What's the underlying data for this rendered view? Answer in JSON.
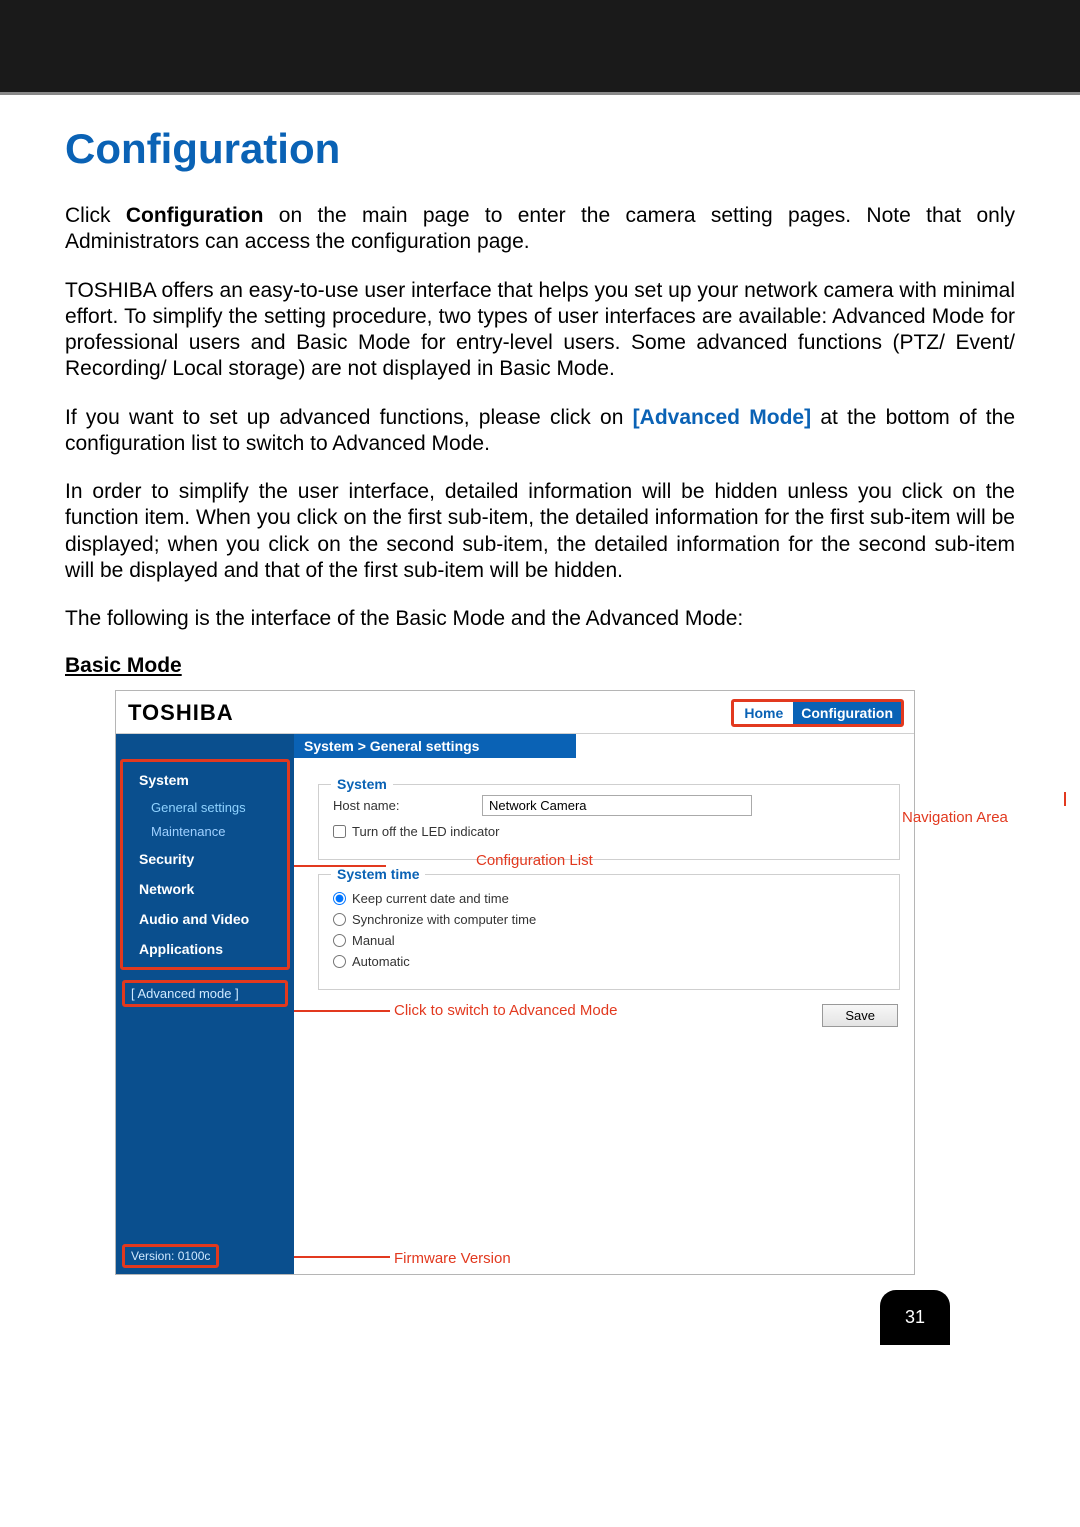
{
  "title": "Configuration",
  "para1_pre": "Click ",
  "para1_bold": "Configuration",
  "para1_post": " on the main page to enter the camera setting pages. Note that only Administrators can access the configuration page.",
  "para2": "TOSHIBA offers an easy-to-use user interface that helps you set up your network camera with minimal effort. To simplify the setting procedure, two types of user interfaces are available: Advanced Mode for professional users and Basic Mode for entry-level users. Some advanced functions (PTZ/ Event/ Recording/ Local storage) are not displayed in Basic Mode.",
  "para3_pre": "If you want to set up advanced functions, please click on ",
  "para3_link": "[Advanced Mode]",
  "para3_post": " at the bottom of the configuration list to switch to Advanced Mode.",
  "para4": "In order to simplify the user interface, detailed information will be hidden unless you click on the function item. When you click on the first sub-item, the detailed information for the first sub-item will be displayed; when you click on the second sub-item, the detailed information for the second sub-item will be displayed and that of the first sub-item will be hidden.",
  "para5": "The following is the interface of the Basic Mode and the Advanced Mode:",
  "subhead": "Basic Mode",
  "shot": {
    "brand": "TOSHIBA",
    "nav_home": "Home",
    "nav_config": "Configuration",
    "breadcrumb": "System  >  General settings",
    "sidebar": {
      "system": "System",
      "general": "General settings",
      "maintenance": "Maintenance",
      "security": "Security",
      "network": "Network",
      "av": "Audio and Video",
      "apps": "Applications",
      "advmode": "[ Advanced mode ]",
      "version": "Version: 0100c"
    },
    "panel_system": {
      "legend": "System",
      "host_label": "Host name:",
      "host_value": "Network Camera",
      "led_chk": "Turn off the LED indicator"
    },
    "panel_time": {
      "legend": "System time",
      "r1": "Keep current date and time",
      "r2": "Synchronize with computer time",
      "r3": "Manual",
      "r4": "Automatic"
    },
    "save": "Save",
    "annotations": {
      "nav": "Navigation Area",
      "conf": "Configuration List",
      "adv": "Click to switch to Advanced Mode",
      "fw": "Firmware Version"
    }
  },
  "pagenum": "31"
}
